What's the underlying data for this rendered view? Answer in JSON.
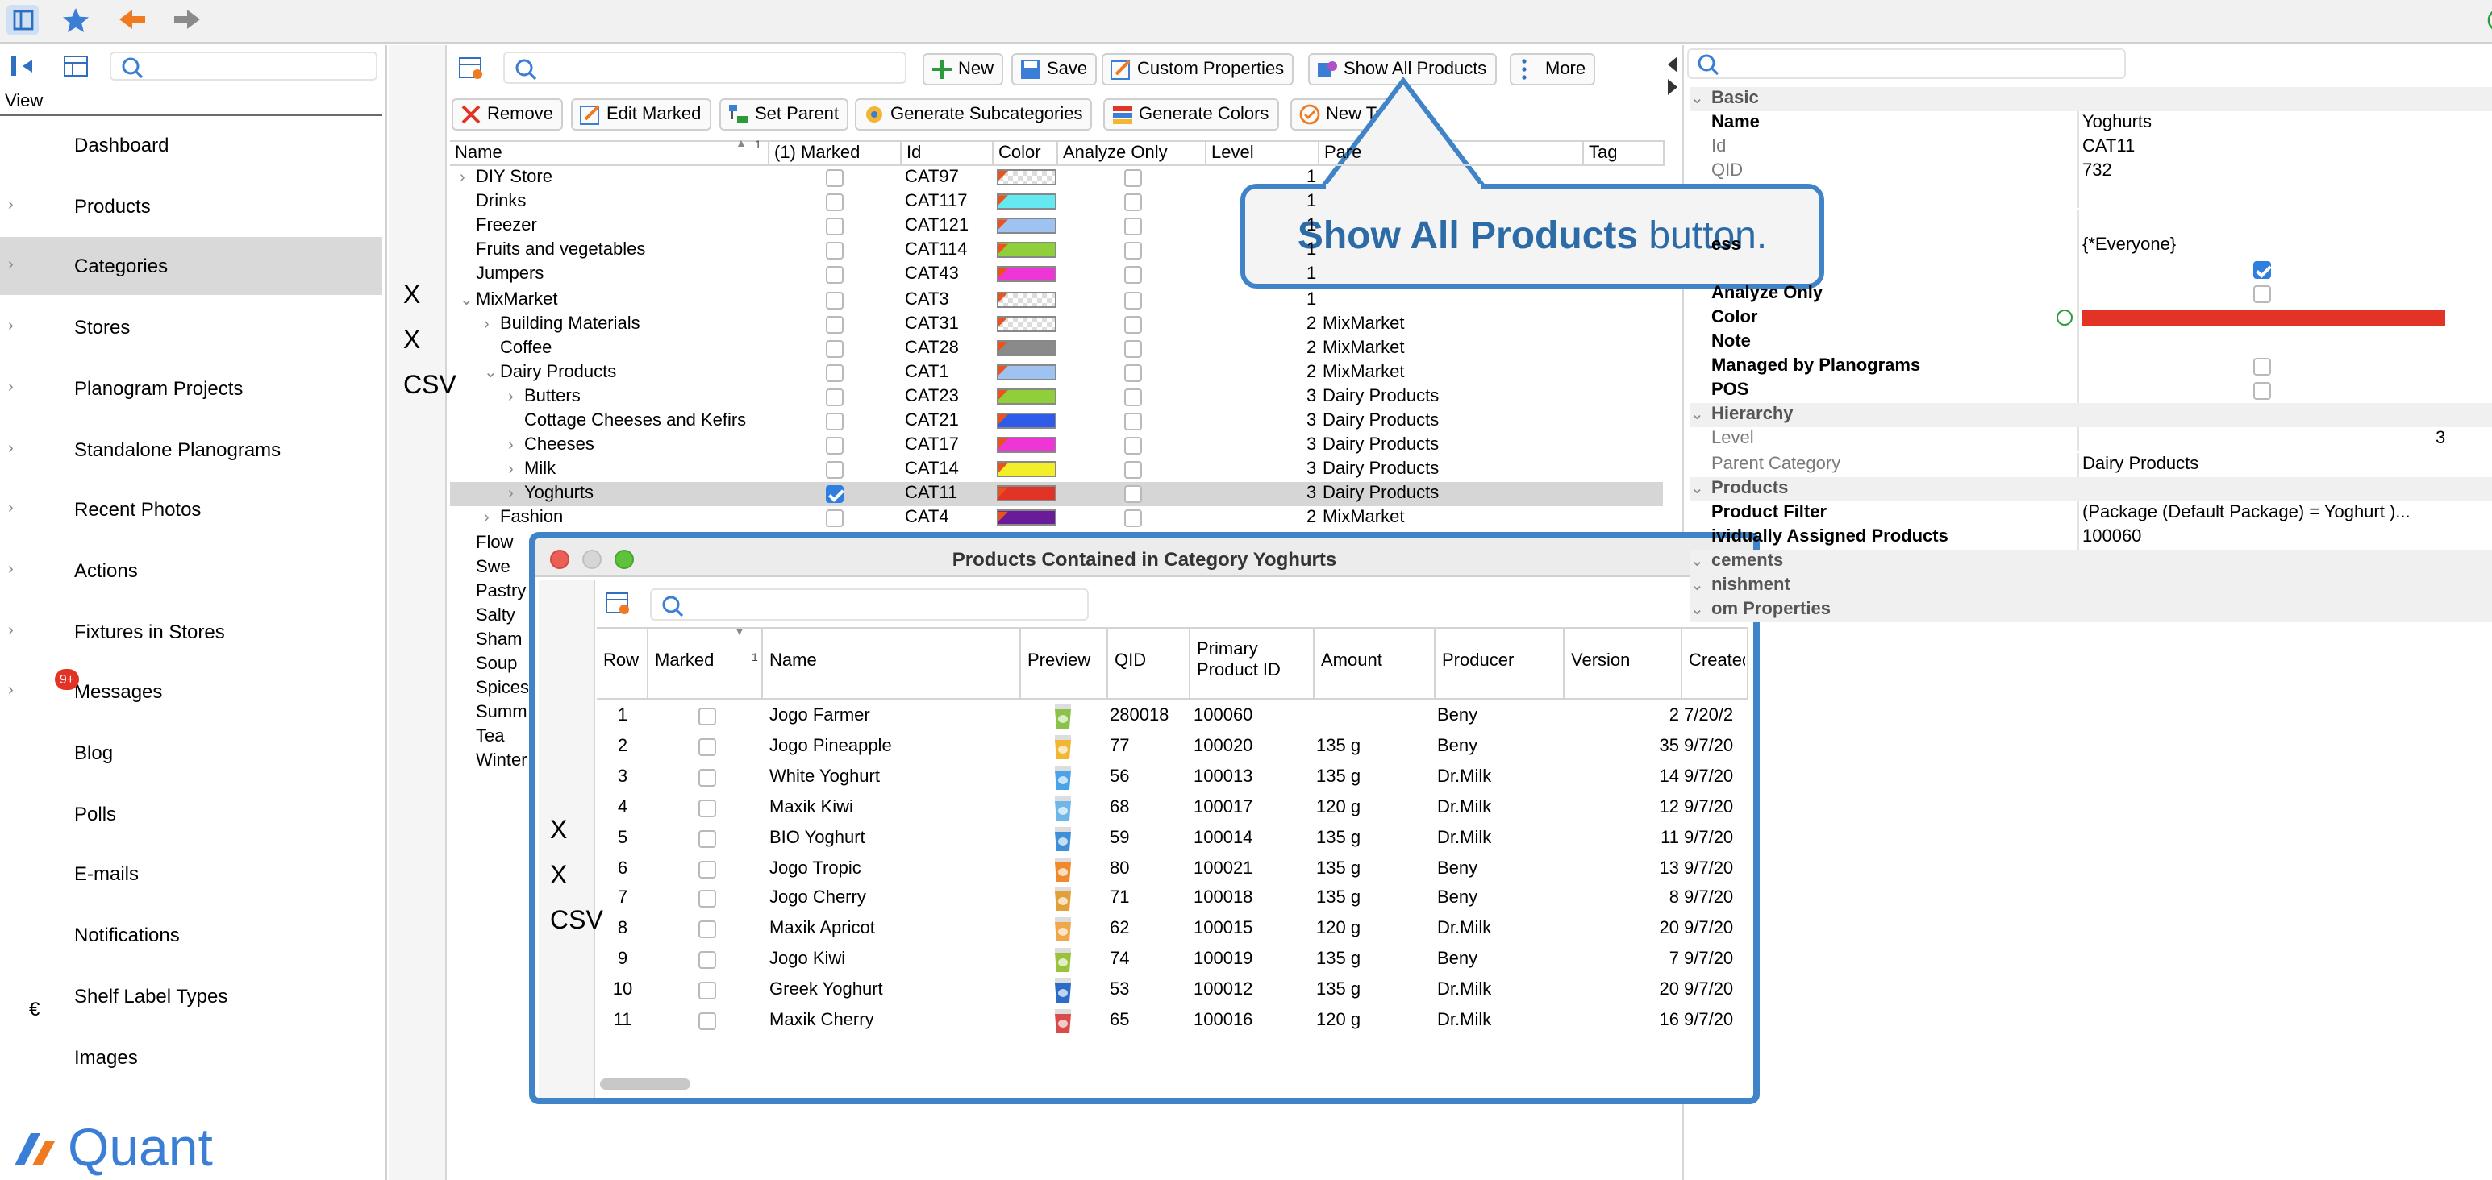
{
  "toolbar": {
    "view_label": "View"
  },
  "sidebar": {
    "items": [
      {
        "label": "Dashboard",
        "icon": "dashboard-icon"
      },
      {
        "label": "Products",
        "icon": "products-icon"
      },
      {
        "label": "Categories",
        "icon": "categories-icon"
      },
      {
        "label": "Stores",
        "icon": "stores-icon"
      },
      {
        "label": "Planogram Projects",
        "icon": "planogram-projects-icon"
      },
      {
        "label": "Standalone Planograms",
        "icon": "standalone-planograms-icon"
      },
      {
        "label": "Recent Photos",
        "icon": "recent-photos-icon"
      },
      {
        "label": "Actions",
        "icon": "actions-icon"
      },
      {
        "label": "Fixtures in Stores",
        "icon": "fixtures-icon"
      },
      {
        "label": "Messages",
        "icon": "messages-icon",
        "badge": "9+"
      },
      {
        "label": "Blog",
        "icon": "blog-icon"
      },
      {
        "label": "Polls",
        "icon": "polls-icon"
      },
      {
        "label": "E-mails",
        "icon": "emails-icon"
      },
      {
        "label": "Notifications",
        "icon": "notifications-icon"
      },
      {
        "label": "Shelf Label Types",
        "icon": "shelf-label-icon"
      },
      {
        "label": "Images",
        "icon": "images-icon"
      }
    ],
    "logo": "Quant"
  },
  "main_toolbar": {
    "new": "New",
    "save": "Save",
    "custom": "Custom Properties",
    "show_all": "Show All Products",
    "more": "More",
    "remove": "Remove",
    "edit_marked": "Edit Marked",
    "set_parent": "Set Parent",
    "gen_sub": "Generate Subcategories",
    "gen_colors": "Generate Colors",
    "new_tag": "New Ta"
  },
  "grid": {
    "columns": [
      "Name",
      "(1) Marked",
      "Id",
      "Color",
      "Analyze Only",
      "Level",
      "Pare",
      "Tag"
    ],
    "sort_marker": "1",
    "rows": [
      {
        "name": "DIY Store",
        "id": "CAT97",
        "color": "checker",
        "level": "1",
        "parent": "",
        "marked": false
      },
      {
        "name": "Drinks",
        "id": "CAT117",
        "color": "#66e8f0",
        "level": "1",
        "parent": "",
        "marked": false
      },
      {
        "name": "Freezer",
        "id": "CAT121",
        "color": "#9ec3f0",
        "level": "1",
        "parent": "",
        "marked": false
      },
      {
        "name": "Fruits and vegetables",
        "id": "CAT114",
        "color": "#8fcf3a",
        "level": "1",
        "parent": "",
        "marked": false
      },
      {
        "name": "Jumpers",
        "id": "CAT43",
        "color": "#ee36d6",
        "level": "1",
        "parent": "",
        "marked": false
      },
      {
        "name": "MixMarket",
        "id": "CAT3",
        "color": "checker",
        "level": "1",
        "parent": "",
        "marked": false
      },
      {
        "name": "Building Materials",
        "id": "CAT31",
        "color": "checker",
        "level": "2",
        "parent": "MixMarket",
        "marked": false
      },
      {
        "name": "Coffee",
        "id": "CAT28",
        "color": "#8a8a8a",
        "level": "2",
        "parent": "MixMarket",
        "marked": false
      },
      {
        "name": "Dairy Products",
        "id": "CAT1",
        "color": "#9ec3f0",
        "level": "2",
        "parent": "MixMarket",
        "marked": false
      },
      {
        "name": "Butters",
        "id": "CAT23",
        "color": "#8fcf3a",
        "level": "3",
        "parent": "Dairy Products",
        "marked": false
      },
      {
        "name": "Cottage Cheeses and Kefirs",
        "id": "CAT21",
        "color": "#2e5bea",
        "level": "3",
        "parent": "Dairy Products",
        "marked": false
      },
      {
        "name": "Cheeses",
        "id": "CAT17",
        "color": "#ee36d6",
        "level": "3",
        "parent": "Dairy Products",
        "marked": false
      },
      {
        "name": "Milk",
        "id": "CAT14",
        "color": "#f2ef2a",
        "level": "3",
        "parent": "Dairy Products",
        "marked": false
      },
      {
        "name": "Yoghurts",
        "id": "CAT11",
        "color": "#e23327",
        "level": "3",
        "parent": "Dairy Products",
        "marked": true
      },
      {
        "name": "Fashion",
        "id": "CAT4",
        "color": "#6a1b9a",
        "level": "2",
        "parent": "MixMarket",
        "marked": false
      },
      {
        "name": "Flow"
      },
      {
        "name": "Swe"
      },
      {
        "name": "Pastry"
      },
      {
        "name": "Salty"
      },
      {
        "name": "Sham"
      },
      {
        "name": "Soup"
      },
      {
        "name": "Spices"
      },
      {
        "name": "Summ"
      },
      {
        "name": "Tea"
      },
      {
        "name": "Winter"
      }
    ]
  },
  "callout": {
    "bold": "Show All Products",
    "rest": " button."
  },
  "props": {
    "rows": [
      {
        "label": "Basic",
        "value": "",
        "kind": "section"
      },
      {
        "label": "Name",
        "value": "Yoghurts",
        "kind": "bold"
      },
      {
        "label": "Id",
        "value": "CAT11",
        "kind": "gray"
      },
      {
        "label": "QID",
        "value": "732",
        "kind": "gray"
      },
      {
        "label": "",
        "value": "",
        "kind": "bold"
      },
      {
        "label": "",
        "value": "",
        "kind": "bold"
      },
      {
        "label": "ess",
        "value": "{*Everyone}",
        "kind": "bold"
      },
      {
        "label": "",
        "value": "",
        "kind": "check-on"
      },
      {
        "label": "Analyze Only",
        "value": "",
        "kind": "check"
      },
      {
        "label": "Color",
        "value": "#e23327",
        "kind": "color"
      },
      {
        "label": "Note",
        "value": "",
        "kind": "bold"
      },
      {
        "label": "Managed by Planograms",
        "value": "",
        "kind": "check"
      },
      {
        "label": "POS",
        "value": "",
        "kind": "check"
      },
      {
        "label": "Hierarchy",
        "value": "",
        "kind": "section"
      },
      {
        "label": "Level",
        "value": "3",
        "kind": "gray-right"
      },
      {
        "label": "Parent Category",
        "value": "Dairy Products",
        "kind": "gray"
      },
      {
        "label": "Products",
        "value": "",
        "kind": "section"
      },
      {
        "label": "Product Filter",
        "value": "(Package (Default Package) = Yoghurt )...",
        "kind": "bold"
      },
      {
        "label": "ividually Assigned Products",
        "value": "100060",
        "kind": "bold"
      },
      {
        "label": "cements",
        "value": "",
        "kind": "section"
      },
      {
        "label": "nishment",
        "value": "",
        "kind": "section"
      },
      {
        "label": "om Properties",
        "value": "",
        "kind": "section"
      }
    ]
  },
  "modal": {
    "title": "Products Contained in Category Yoghurts",
    "columns": [
      "Row",
      "Marked",
      "Name",
      "Preview",
      "QID",
      "Primary Product ID",
      "Amount",
      "Producer",
      "Version",
      "Created"
    ],
    "sort_marker": "1",
    "rows": [
      {
        "row": "1",
        "name": "Jogo Farmer",
        "qid": "280018",
        "pid": "100060",
        "amount": "",
        "producer": "Beny",
        "version": "2",
        "created": "7/20/2",
        "color": "#8bc34a"
      },
      {
        "row": "2",
        "name": "Jogo Pineapple",
        "qid": "77",
        "pid": "100020",
        "amount": "135 g",
        "producer": "Beny",
        "version": "35",
        "created": "9/7/20",
        "color": "#f2b632"
      },
      {
        "row": "3",
        "name": "White Yoghurt",
        "qid": "56",
        "pid": "100013",
        "amount": "135 g",
        "producer": "Dr.Milk",
        "version": "14",
        "created": "9/7/20",
        "color": "#4aa3e8"
      },
      {
        "row": "4",
        "name": "Maxik Kiwi",
        "qid": "68",
        "pid": "100017",
        "amount": "120 g",
        "producer": "Dr.Milk",
        "version": "12",
        "created": "9/7/20",
        "color": "#6fb7e9"
      },
      {
        "row": "5",
        "name": "BIO Yoghurt",
        "qid": "59",
        "pid": "100014",
        "amount": "135 g",
        "producer": "Dr.Milk",
        "version": "11",
        "created": "9/7/20",
        "color": "#3f8fd8"
      },
      {
        "row": "6",
        "name": "Jogo Tropic",
        "qid": "80",
        "pid": "100021",
        "amount": "135 g",
        "producer": "Beny",
        "version": "13",
        "created": "9/7/20",
        "color": "#ef8a2a"
      },
      {
        "row": "7",
        "name": "Jogo Cherry",
        "qid": "71",
        "pid": "100018",
        "amount": "135 g",
        "producer": "Beny",
        "version": "8",
        "created": "9/7/20",
        "color": "#e2a03a"
      },
      {
        "row": "8",
        "name": "Maxik Apricot",
        "qid": "62",
        "pid": "100015",
        "amount": "120 g",
        "producer": "Dr.Milk",
        "version": "20",
        "created": "9/7/20",
        "color": "#f0a64a"
      },
      {
        "row": "9",
        "name": "Jogo Kiwi",
        "qid": "74",
        "pid": "100019",
        "amount": "135 g",
        "producer": "Beny",
        "version": "7",
        "created": "9/7/20",
        "color": "#9bc23b"
      },
      {
        "row": "10",
        "name": "Greek Yoghurt",
        "qid": "53",
        "pid": "100012",
        "amount": "135 g",
        "producer": "Dr.Milk",
        "version": "20",
        "created": "9/7/20",
        "color": "#2c6cc8"
      },
      {
        "row": "11",
        "name": "Maxik Cherry",
        "qid": "65",
        "pid": "100016",
        "amount": "120 g",
        "producer": "Dr.Milk",
        "version": "16",
        "created": "9/7/20",
        "color": "#d94b4b"
      }
    ]
  },
  "colors": {
    "accent": "#2f7fe0",
    "modal_border": "#3f83c8",
    "callout_text": "#2c6ba6",
    "selection": "#d6d6d6"
  }
}
